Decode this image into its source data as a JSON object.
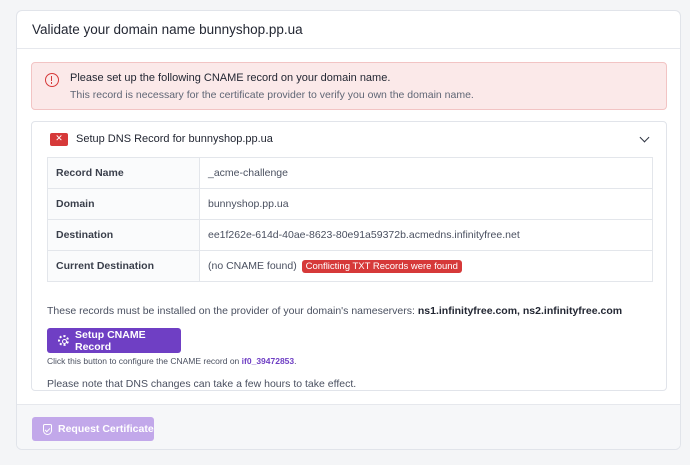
{
  "card": {
    "title": "Validate your domain name bunnyshop.pp.ua"
  },
  "alert": {
    "title": "Please set up the following CNAME record on your domain name.",
    "subtitle": "This record is necessary for the certificate provider to verify you own the domain name."
  },
  "dns_panel": {
    "badge": "✕",
    "title": "Setup DNS Record for bunnyshop.pp.ua",
    "rows": [
      {
        "key": "Record Name",
        "value": "_acme-challenge"
      },
      {
        "key": "Domain",
        "value": "bunnyshop.pp.ua"
      },
      {
        "key": "Destination",
        "value": "ee1f262e-614d-40ae-8623-80e91a59372b.acmedns.infinityfree.net"
      },
      {
        "key": "Current Destination",
        "value": "(no CNAME found)",
        "badge": "Conflicting TXT Records were found"
      }
    ],
    "nameservers_text": "These records must be installed on the provider of your domain's nameservers:",
    "nameservers": "ns1.infinityfree.com, ns2.infinityfree.com",
    "setup_button": "Setup CNAME Record",
    "hint_text": "Click this button to configure the CNAME record on",
    "hint_account": "if0_39472853",
    "hint_end": ".",
    "dns_note": "Please note that DNS changes can take a few hours to take effect."
  },
  "footer": {
    "request_button": "Request Certificate"
  },
  "colors": {
    "accent": "#6f3fc4",
    "danger": "#d63939",
    "disabled_accent": "#c2a8ea"
  }
}
